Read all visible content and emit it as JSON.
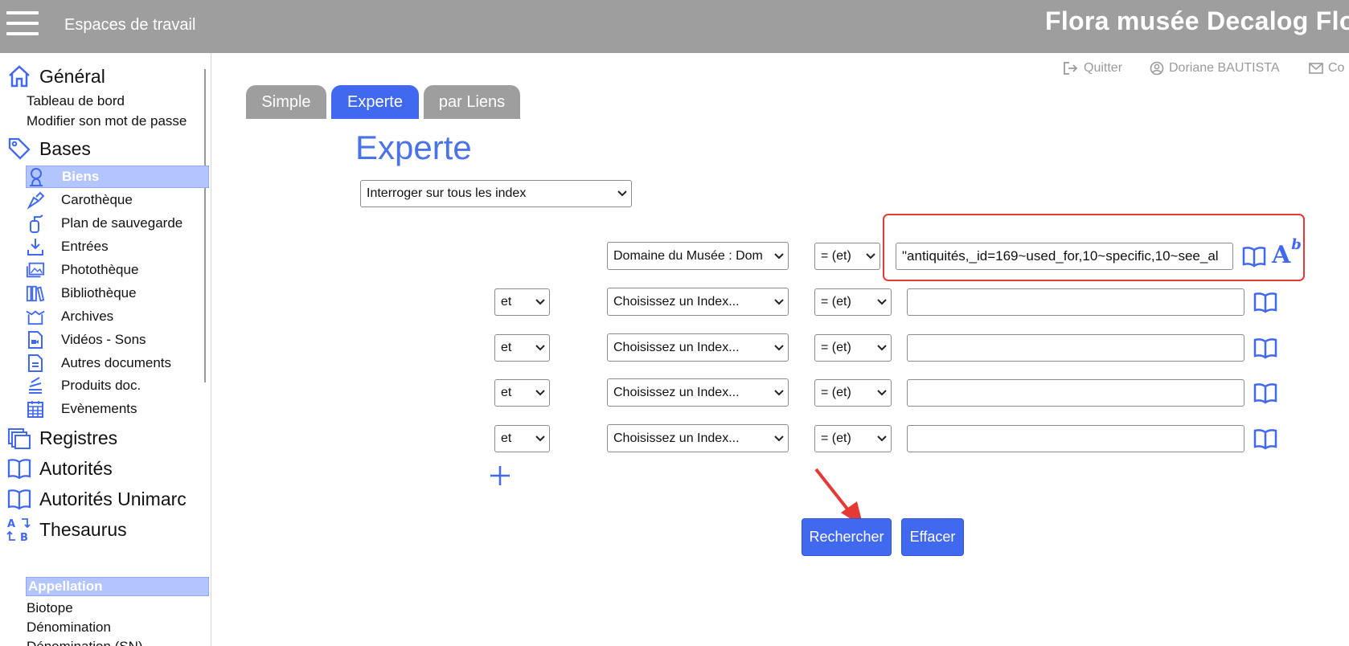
{
  "header": {
    "workspaces": "Espaces de travail",
    "brand": "Flora musée Decalog Flo"
  },
  "sidebar": {
    "general": {
      "label": "Général",
      "items": [
        "Tableau de bord",
        "Modifier son mot de passe"
      ]
    },
    "bases": {
      "label": "Bases",
      "items": [
        "Biens",
        "Carothèque",
        "Plan de sauvegarde",
        "Entrées",
        "Photothèque",
        "Bibliothèque",
        "Archives",
        "Vidéos - Sons",
        "Autres documents",
        "Produits doc.",
        "Evènements"
      ]
    },
    "registres": "Registres",
    "autorites": "Autorités",
    "autorites_unimarc": "Autorités Unimarc",
    "thesaurus": {
      "label": "Thesaurus",
      "items": [
        "Appellation",
        "Biotope",
        "Dénomination",
        "Dénomination (SN)"
      ]
    }
  },
  "user_bar": {
    "quit": "Quitter",
    "user": "Doriane BAUTISTA",
    "contact": "Co"
  },
  "tabs": [
    "Simple",
    "Experte",
    "par Liens"
  ],
  "title": "Experte",
  "index_select": "Interroger sur tous les index",
  "rows": [
    {
      "connector": "",
      "index": "Domaine du Musée : Dom",
      "operator": "= (et)",
      "value": "\"antiquités,_id=169~used_for,10~specific,10~see_al"
    },
    {
      "connector": "et",
      "index": "Choisissez un Index...",
      "operator": "= (et)",
      "value": ""
    },
    {
      "connector": "et",
      "index": "Choisissez un Index...",
      "operator": "= (et)",
      "value": ""
    },
    {
      "connector": "et",
      "index": "Choisissez un Index...",
      "operator": "= (et)",
      "value": ""
    },
    {
      "connector": "et",
      "index": "Choisissez un Index...",
      "operator": "= (et)",
      "value": ""
    }
  ],
  "buttons": {
    "search": "Rechercher",
    "clear": "Effacer"
  },
  "colors": {
    "accent": "#4169f0",
    "header": "#9e9e9e",
    "highlight": "#b3c5ff",
    "annotation": "#e53935"
  }
}
